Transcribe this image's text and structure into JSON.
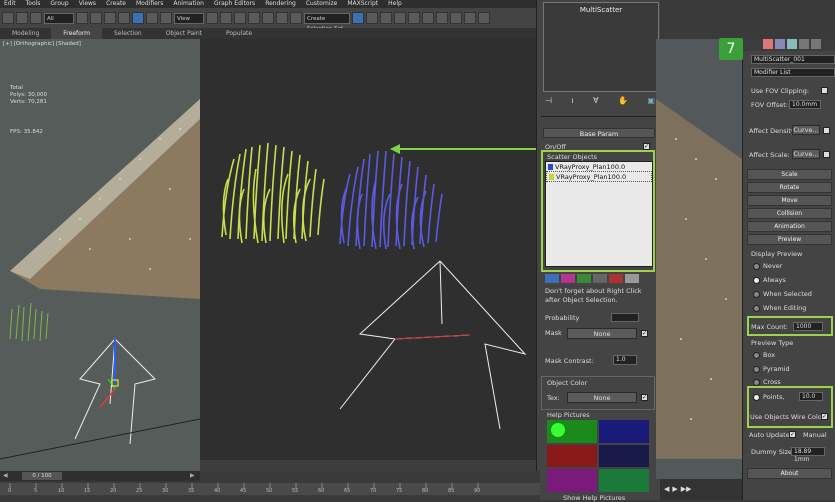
{
  "menu": [
    "Edit",
    "Tools",
    "Group",
    "Views",
    "Create",
    "Modifiers",
    "Animation",
    "Graph Editors",
    "Rendering",
    "Customize",
    "MAXScript",
    "Help"
  ],
  "toolbar": {
    "selection_filter": "All",
    "ref_coord": "View",
    "named_selection": "Create Selection Set"
  },
  "ribbon_tabs": [
    "Modeling",
    "Freeform",
    "Selection",
    "Object Paint",
    "Populate"
  ],
  "left_viewport": {
    "label": "[+] [Orthographic] [Shaded]",
    "stats": {
      "total": "Total",
      "polys": "Polys:  30,000",
      "verts": "Verts:  70,281",
      "fps": "FPS:   35.842"
    }
  },
  "timeline": {
    "counter": "0 / 100",
    "ticks": [
      "0",
      "5",
      "10",
      "15",
      "20",
      "25",
      "30",
      "35",
      "40",
      "45",
      "50",
      "55",
      "60",
      "65",
      "70",
      "75",
      "80",
      "85",
      "90"
    ]
  },
  "multiscatter": {
    "title": "MultiScatter",
    "base_param": "Base Param",
    "on_off": "On/Off",
    "scatter_objects_label": "Scatter Objects",
    "scatter_objects": [
      {
        "name": "VRayProxy_Plan",
        "value": "100.0"
      },
      {
        "name": "VRayProxy_Plan",
        "value": "100.0"
      }
    ],
    "hint": "Don't forget about Right Click after Object Selection.",
    "probability": "Probability",
    "mask": "Mask",
    "mask_value": "None",
    "mask_contrast": "Mask Contrast:",
    "mask_contrast_value": "1.0",
    "object_color": "Object Color",
    "tex": "Tex:",
    "tex_value": "None",
    "help_pictures": "Help Pictures",
    "show_help": "Show Help Pictures"
  },
  "command_panel": {
    "badge": "7",
    "object_name": "MultiScatter_001",
    "modifier_list": "Modifier List",
    "use_fov_clipping": "Use FOV Clipping:",
    "fov_offset": "FOV Offset:",
    "fov_offset_value": "10.0mm",
    "affect_density": "Affect Density:",
    "affect_density_btn": "Curve...",
    "affect_scale": "Affect Scale:",
    "affect_scale_btn": "Curve...",
    "rollouts": [
      "Scale",
      "Rotate",
      "Move",
      "Collision",
      "Animation",
      "Preview"
    ],
    "display_preview": "Display Preview",
    "display_options": [
      {
        "label": "Never",
        "on": false
      },
      {
        "label": "Always",
        "on": true
      },
      {
        "label": "When Selected",
        "on": false
      },
      {
        "label": "When Editing",
        "on": false
      }
    ],
    "max_count": "Max Count:",
    "max_count_value": "1000",
    "preview_type": "Preview Type",
    "preview_options": [
      {
        "label": "Box",
        "on": false
      },
      {
        "label": "Pyramid",
        "on": false
      },
      {
        "label": "Cross",
        "on": false
      }
    ],
    "points": "Points,",
    "points_value": "10.0",
    "use_objects_wire_color": "Use Objects Wire Color",
    "auto_update": "Auto Update",
    "manual": "Manual",
    "dummy_size": "Dummy Size:",
    "dummy_size_value": "18.89 1mm",
    "about": "About"
  },
  "colors": {
    "highlight": "#9dd34a",
    "grass_yellow": "#c8e04a",
    "grass_blue": "#5a5ae6"
  }
}
